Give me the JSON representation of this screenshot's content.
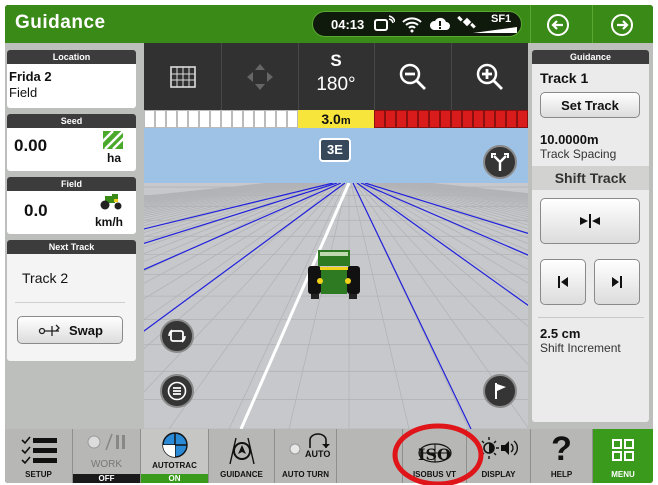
{
  "header": {
    "title": "Guidance",
    "clock": "04:13",
    "receiver_label": "SF1",
    "status_icons": [
      "receiver-connection-icon",
      "wifi-icon",
      "cloud-alert-icon",
      "gps-satellite-icon"
    ],
    "nav_icons": [
      "back-arrow-icon",
      "forward-arrow-icon"
    ]
  },
  "left_panel": {
    "location": {
      "header": "Location",
      "line1": "Frida 2",
      "line2": "Field"
    },
    "seed": {
      "header": "Seed",
      "value": "0.00",
      "unit": "ha"
    },
    "field": {
      "header": "Field",
      "value": "0.0",
      "unit": "km/h"
    },
    "next_track": {
      "header": "Next Track",
      "track": "Track 2",
      "swap_label": "Swap"
    }
  },
  "center": {
    "toolbar_icons": [
      "field-map-icon",
      "pan-icon",
      "zoom-out-icon",
      "zoom-in-icon"
    ],
    "heading_dir": "S",
    "heading_deg": "180°",
    "offset_value": "3.0",
    "offset_unit": "m",
    "pass_number": "3E",
    "round_icons": [
      "view-mode-icon",
      "list-icon",
      "flag-icon",
      "track-branch-icon"
    ]
  },
  "right_panel": {
    "header": "Guidance",
    "track_name": "Track 1",
    "set_track_label": "Set Track",
    "spacing_value": "10.0000m",
    "spacing_label": "Track Spacing",
    "shift_header": "Shift Track",
    "shift_increment_value": "2.5 cm",
    "shift_increment_label": "Shift Increment"
  },
  "bottom_bar": {
    "setup": "SETUP",
    "work": "WORK",
    "work_state": "OFF",
    "autotrac": "AUTOTRAC",
    "autotrac_state": "ON",
    "guidance": "GUIDANCE",
    "auto_turn": "AUTO TURN",
    "auto_turn_badge": "AUTO",
    "isobus": "ISOBUS VT",
    "isobus_logo": "ISO",
    "display": "DISPLAY",
    "help": "HELP",
    "menu": "MENU"
  },
  "colors": {
    "header_green": "#3a8a18",
    "menu_green": "#3a9a1c",
    "state_off": "#1a1a1a",
    "state_on": "#3a9a1c",
    "offset_yellow": "#f7e53c",
    "highlight_circle": "#e0151a",
    "sky_blue": "#9ec2e5"
  }
}
